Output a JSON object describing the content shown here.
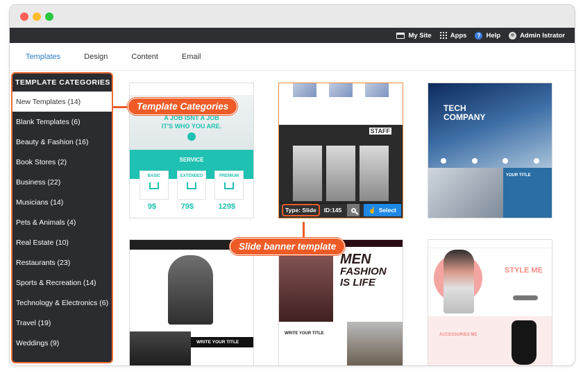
{
  "topbar": {
    "items": [
      {
        "label": "My Site",
        "icon": "browser-window-icon"
      },
      {
        "label": "Apps",
        "icon": "apps-grid-icon"
      },
      {
        "label": "Help",
        "icon": "help-circle-icon"
      },
      {
        "label": "Admin Istrator",
        "icon": "user-avatar-icon"
      }
    ]
  },
  "tabs": [
    {
      "label": "Templates",
      "active": true
    },
    {
      "label": "Design"
    },
    {
      "label": "Content"
    },
    {
      "label": "Email"
    }
  ],
  "sidebar": {
    "title": "TEMPLATE CATEGORIES",
    "items": [
      {
        "label": "New Templates (14)",
        "active": true
      },
      {
        "label": "Blank Templates (6)"
      },
      {
        "label": "Beauty & Fashion (16)"
      },
      {
        "label": "Book Stores (2)"
      },
      {
        "label": "Business (22)"
      },
      {
        "label": "Musicians (14)"
      },
      {
        "label": "Pets & Animals (4)"
      },
      {
        "label": "Real Estate (10)"
      },
      {
        "label": "Restaurants (23)"
      },
      {
        "label": "Sports & Recreation (14)"
      },
      {
        "label": "Technology & Electronics (6)"
      },
      {
        "label": "Travel (19)"
      },
      {
        "label": "Weddings (9)"
      }
    ]
  },
  "callouts": {
    "categories": "Template Categories",
    "slide": "Slide banner template"
  },
  "thumb1": {
    "hero_line1": "A JOB ISNT A JOB",
    "hero_line2": "IT'S WHO YOU ARE.",
    "service": "SERVICE",
    "cards": [
      "BASIC",
      "EXTENDED",
      "PREMIUM"
    ],
    "prices": [
      "9$",
      "79$",
      "129$"
    ]
  },
  "thumb2": {
    "staff": "STAFF",
    "type_label": "Type: Slide",
    "id_label": "ID:145",
    "select_label": "Select"
  },
  "thumb3": {
    "title_line1": "TECH",
    "title_line2": "COMPANY",
    "box_title": "YOUR TITLE"
  },
  "thumb4": {
    "write_title": "WRITE YOUR TITLE"
  },
  "thumb5": {
    "line1": "MEN",
    "line2": "FASHION",
    "line3": "IS LIFE",
    "write_title": "WRITE YOUR TITLE"
  },
  "thumb6": {
    "style_me": "STYLE ME",
    "accessories": "ACCESSORIES ME"
  },
  "colors": {
    "accent": "#ee5b27",
    "tab_active": "#2a7dc4",
    "sidebar_bg": "#2b2c30",
    "select_blue": "#1e88e5"
  }
}
